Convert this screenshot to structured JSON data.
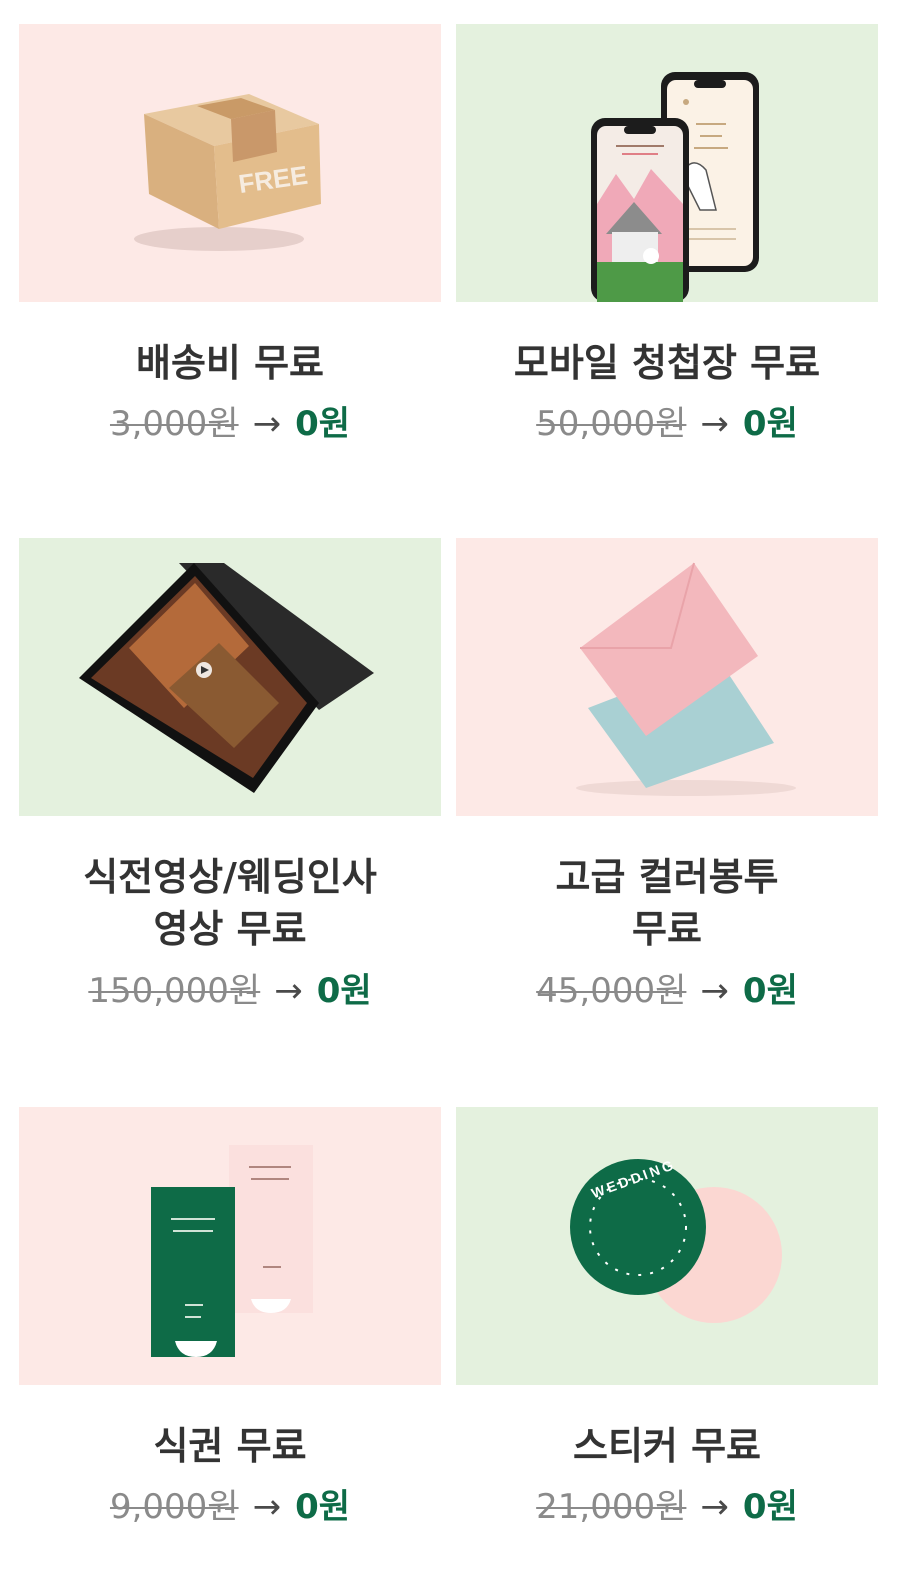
{
  "colors": {
    "pink_bg": "#fde9e6",
    "green_bg": "#e4f1de",
    "accent_green": "#0e6b47",
    "title_text": "#333333",
    "old_price": "#8a8a8a"
  },
  "items": [
    {
      "title_lines": [
        "배송비 무료"
      ],
      "old_price": "3,000원",
      "arrow": "→",
      "new_price": "0원",
      "image": "free-shipping-box",
      "box_label": "FREE"
    },
    {
      "title_lines": [
        "모바일 청첩장 무료"
      ],
      "old_price": "50,000원",
      "arrow": "→",
      "new_price": "0원",
      "image": "mobile-invitation-phones"
    },
    {
      "title_lines": [
        "식전영상/웨딩인사",
        "영상 무료"
      ],
      "old_price": "150,000원",
      "arrow": "→",
      "new_price": "0원",
      "image": "video-tablet"
    },
    {
      "title_lines": [
        "고급 컬러봉투",
        "무료"
      ],
      "old_price": "45,000원",
      "arrow": "→",
      "new_price": "0원",
      "image": "color-envelopes"
    },
    {
      "title_lines": [
        "식권 무료"
      ],
      "old_price": "9,000원",
      "arrow": "→",
      "new_price": "0원",
      "image": "meal-tickets"
    },
    {
      "title_lines": [
        "스티커 무료"
      ],
      "old_price": "21,000원",
      "arrow": "→",
      "new_price": "0원",
      "image": "wedding-stickers",
      "sticker_label": "WEDDING"
    }
  ]
}
